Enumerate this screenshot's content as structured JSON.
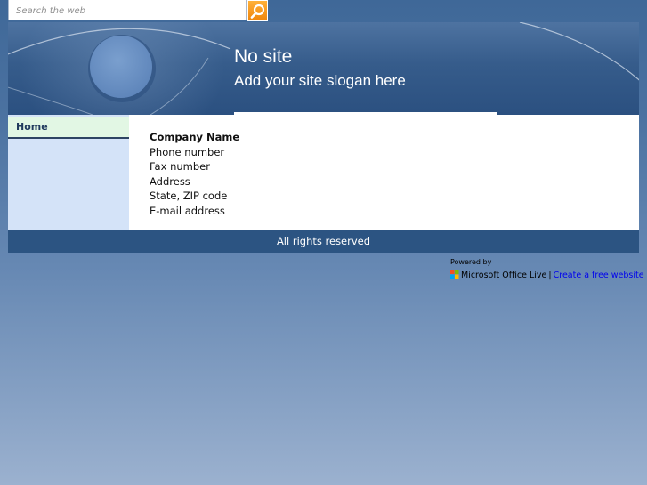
{
  "search": {
    "placeholder": "Search the web",
    "value": ""
  },
  "header": {
    "site_title": "No site",
    "slogan": "Add your site slogan here"
  },
  "nav": {
    "items": [
      {
        "label": "Home",
        "active": true
      }
    ]
  },
  "contact": {
    "company": "Company Name",
    "phone": "Phone number",
    "fax": "Fax number",
    "address": "Address",
    "state_zip": "State, ZIP code",
    "email": "E-mail address"
  },
  "footer": {
    "rights": "All rights reserved"
  },
  "powered": {
    "label": "Powered by",
    "product": "Microsoft Office Live",
    "separator": "|",
    "link": "Create a free website"
  },
  "colors": {
    "page_bg_top": "#3f6898",
    "banner": "#365c8b",
    "search_button": "#f5961e",
    "nav_active_bg": "#e2f7e4",
    "sidebar_bg": "#d4e3f8",
    "footer_bar": "#2c5482",
    "link": "#0000ee"
  },
  "icons": {
    "search_button": "magnifier-icon",
    "ms_logo": "office-live-logo-icon"
  }
}
